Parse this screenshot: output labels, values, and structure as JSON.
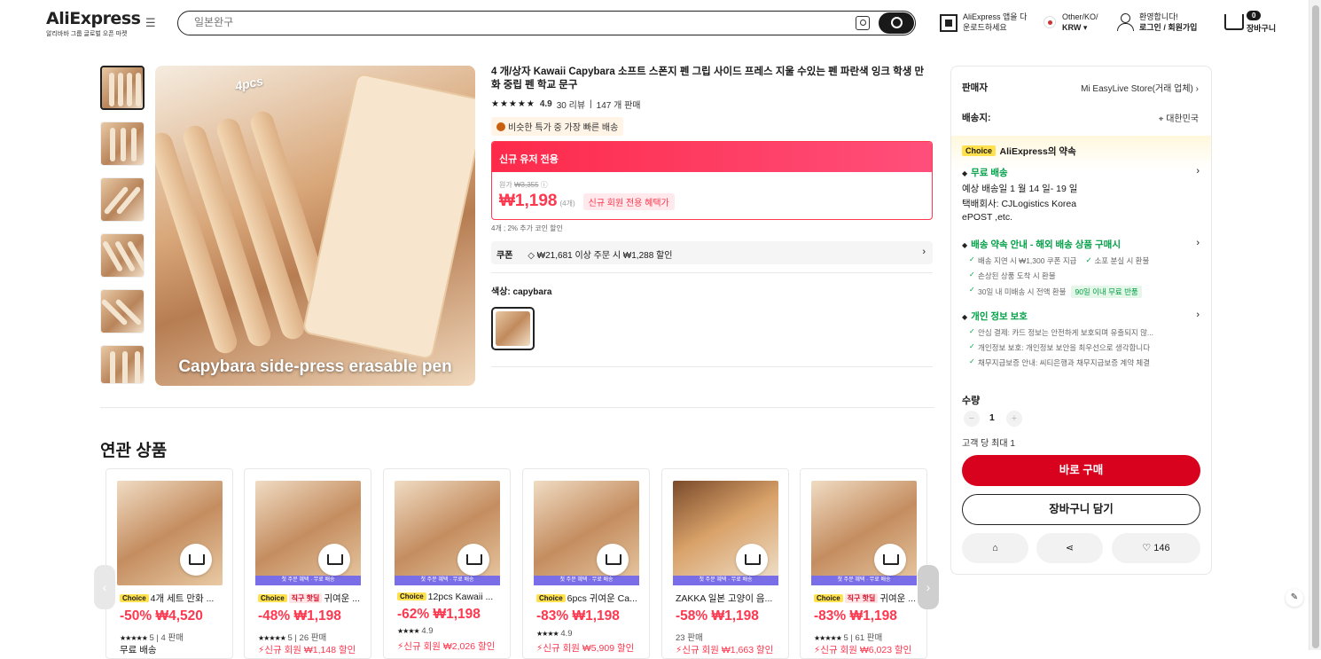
{
  "header": {
    "logo": "AliExpress",
    "logo_sub": "알리바바 그룹 글로벌 오픈 마켓",
    "search_placeholder": "일본완구",
    "app_line1": "AliExpress 앱을 다",
    "app_line2": "운로드하세요",
    "region_line1": "Other/KO/",
    "region_line2": "KRW ▾",
    "user_line1": "환영합니다!",
    "user_line2": "로그인 / 회원가입",
    "cart_count": "0",
    "cart_label": "장바구니"
  },
  "product": {
    "image_tag": "4pcs",
    "image_caption": "Capybara side-press erasable pen",
    "title": "4 개/상자 Kawaii Capybara 소프트 스폰지 펜 그립 사이드 프레스 지울 수있는 펜 파란색 잉크 학생 만화 중립 펜 학교 문구",
    "rating": "4.9",
    "reviews": "30 리뷰",
    "sold": "147 개 판매",
    "fast_badge": "비슷한 특가 중 가장 빠른 배송",
    "promo_banner": "신규 유저 전용",
    "orig_label": "원가",
    "orig_price": "₩3,355",
    "price": "₩1,198",
    "price_unit": "(4개)",
    "new_user_tag": "신규 회원 전용 혜택가",
    "coin_note": "4개 ; 2% 추가 코인 할인",
    "coupon_label": "쿠폰",
    "coupon_text": "₩21,681 이상 주문 시 ₩1,288 할인",
    "color_label": "색상: capybara"
  },
  "related": {
    "heading": "연관 상품",
    "items": [
      {
        "badge": "Choice",
        "badge2": "",
        "title": "4개 세트 만화 ...",
        "price": "-50% ₩4,520",
        "stars": "★★★★★",
        "stat": "5 | 4 판매",
        "bottom": "무료 배송",
        "strip": ""
      },
      {
        "badge": "Choice",
        "badge2": "직구 핫딜",
        "title": "귀여운 ...",
        "price": "-48% ₩1,198",
        "stars": "★★★★★",
        "stat": "5 | 26 판매",
        "bottom": "⚡신규 회원 ₩1,148 할인",
        "strip": "첫 주문 혜택 · 무료 배송"
      },
      {
        "badge": "Choice",
        "badge2": "",
        "title": "12pcs Kawaii ...",
        "price": "-62% ₩1,198",
        "stars": "★★★★",
        "stat": "4.9",
        "bottom": "⚡신규 회원 ₩2,026 할인",
        "strip": "첫 주문 혜택 · 무료 배송"
      },
      {
        "badge": "Choice",
        "badge2": "",
        "title": "6pcs 귀여운 Ca...",
        "price": "-83% ₩1,198",
        "stars": "★★★★",
        "stat": "4.9",
        "bottom": "⚡신규 회원 ₩5,909 할인",
        "strip": "첫 주문 혜택 · 무료 배송"
      },
      {
        "badge": "",
        "badge2": "",
        "title": "ZAKKA 일본 고양이 음...",
        "price": "-58% ₩1,198",
        "stars": "",
        "stat": "23 판매",
        "bottom": "⚡신규 회원 ₩1,663 할인",
        "strip": "첫 주문 혜택 · 무료 배송"
      },
      {
        "badge": "Choice",
        "badge2": "직구 핫딜",
        "title": "귀여운 ...",
        "price": "-83% ₩1,198",
        "stars": "★★★★★",
        "stat": "5 | 61 판매",
        "bottom": "⚡신규 회원 ₩6,023 할인",
        "strip": "첫 주문 혜택 · 무료 배송"
      }
    ]
  },
  "sidebar": {
    "seller_label": "판매자",
    "seller_value": "Mi EasyLive Store(거래 업체) ›",
    "ship_label": "배송지:",
    "ship_value": "대한민국",
    "choice_badge": "Choice",
    "choice_title": "AliExpress의 약속",
    "free_ship": "무료 배송",
    "eta": "예상 배송일 1 월 14 일- 19 일",
    "carrier_line1": "택배회사: CJLogistics  Korea",
    "carrier_line2": "ePOST ,etc.",
    "promise_title": "배송 약속 안내 - 해외 배송 상품 구매시",
    "promise_1a": "배송 지연 시 ₩1,300 쿠폰 지급",
    "promise_1b": "소포 분실 시 환불",
    "promise_2": "손상된 상품 도착 시 환불",
    "promise_3": "30일 내 미배송 시 전액 환불",
    "promise_3_pill": "90일 이내 무료 반품",
    "privacy_title": "개인 정보 보호",
    "privacy_1": "안심 결제: 카드 정보는 안전하게 보호되며 유출되지 않...",
    "privacy_2": "개인정보 보호: 개인정보 보안을 최우선으로 생각합니다",
    "privacy_3": "채무지급보증 안내: 씨티은행과 채무지급보증 계약 체결",
    "qty_label": "수량",
    "qty_value": "1",
    "max_qty": "고객 당 최대 1",
    "buy_now": "바로 구매",
    "add_cart": "장바구니 담기",
    "wishlist_count": "146"
  }
}
